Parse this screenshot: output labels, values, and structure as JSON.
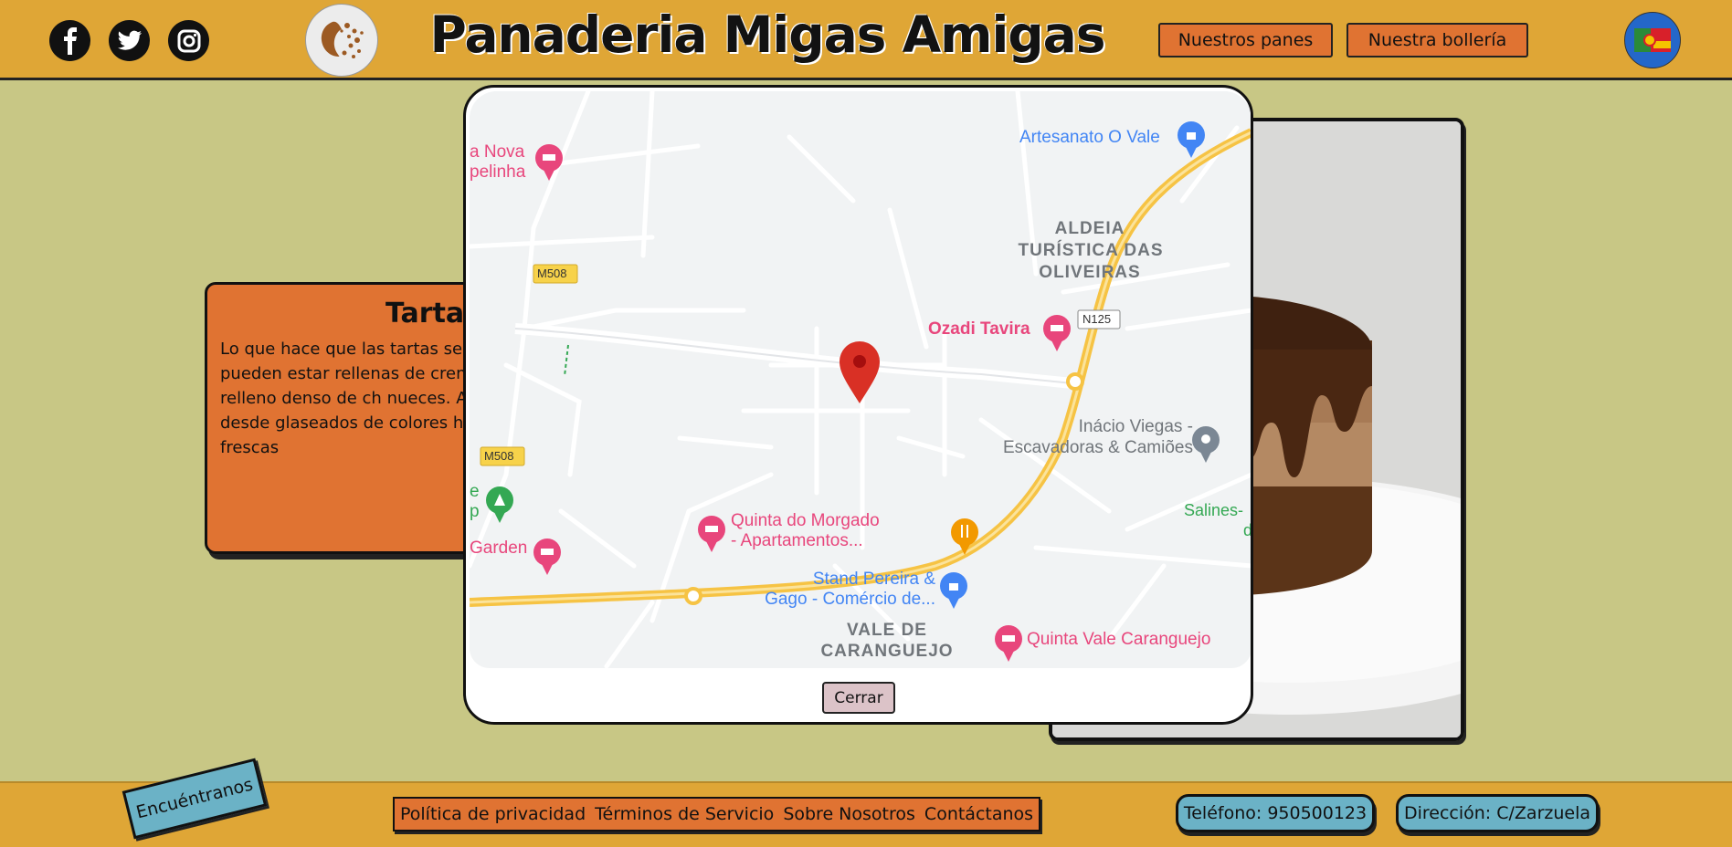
{
  "header": {
    "title": "Panaderia Migas Amigas",
    "social": [
      {
        "name": "facebook-icon",
        "glyph": "f"
      },
      {
        "name": "twitter-icon",
        "glyph": "t"
      },
      {
        "name": "instagram-icon",
        "glyph": "i"
      }
    ],
    "nav": {
      "breads": "Nuestros panes",
      "pastries": "Nuestra bollería"
    }
  },
  "card": {
    "title": "Tartas",
    "text": "Lo que hace que las tartas se es la creatividad que pueden estar rellenas de crema, frut quizás un relleno denso de ch nueces. Además, las cobertu desde glaseados de colores h decoración de frutas frescas"
  },
  "modal": {
    "close_label": "Cerrar",
    "map_labels": {
      "artesanato": "Artesanato O Vale",
      "nova_1": "a Nova",
      "nova_2": "pelinha",
      "aldeia_1": "ALDEIA",
      "aldeia_2": "TURÍSTICA DAS",
      "aldeia_3": "OLIVEIRAS",
      "m508_a": "M508",
      "m508_b": "M508",
      "n125": "N125",
      "ozadi": "Ozadi Tavira",
      "inacio_1": "Inácio Viegas -",
      "inacio_2": "Escavadoras & Camiões",
      "salines_1": "Salines-",
      "salines_2": "d",
      "quinta_morgado_1": "Quinta do Morgado",
      "quinta_morgado_2": "- Apartamentos...",
      "garden": "Garden",
      "e_p_1": "e",
      "e_p_2": "p",
      "stand_1": "Stand Pereira &",
      "stand_2": "Gago - Comércio de...",
      "vale_1": "VALE DE",
      "vale_2": "CARANGUEJO",
      "quinta_vale": "Quinta Vale Caranguejo"
    }
  },
  "footer": {
    "find_us": "Encuéntranos",
    "links": [
      "Política de privacidad",
      "Términos de Servicio",
      "Sobre Nosotros",
      "Contáctanos"
    ],
    "phone": "Teléfono: 950500123",
    "address": "Dirección: C/Zarzuela"
  },
  "colors": {
    "header_bg": "#dfa636",
    "page_bg": "#c8c785",
    "accent_orange": "#e07332",
    "accent_blue": "#6bb2c6",
    "map_poi_pink": "#e8467c",
    "map_poi_blue": "#4285f4",
    "map_road_yellow": "#f6c344",
    "map_pin_red": "#d93025"
  }
}
